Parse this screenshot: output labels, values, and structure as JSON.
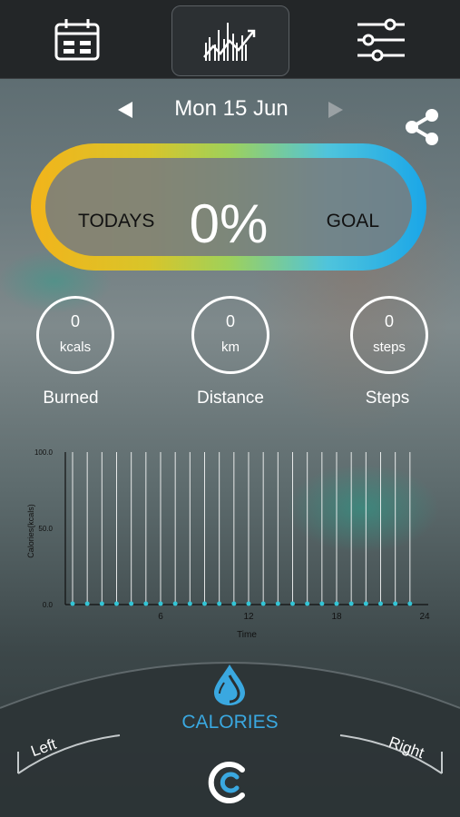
{
  "topbar": {
    "icons": [
      "calendar-icon",
      "chart-icon",
      "settings-sliders-icon"
    ]
  },
  "date": {
    "label": "Mon 15 Jun"
  },
  "goal": {
    "left_label": "TODAYS",
    "percent": "0%",
    "right_label": "GOAL",
    "progress": 0
  },
  "stats": [
    {
      "value": "0",
      "unit": "kcals",
      "label": "Burned"
    },
    {
      "value": "0",
      "unit": "km",
      "label": "Distance"
    },
    {
      "value": "0",
      "unit": "steps",
      "label": "Steps"
    }
  ],
  "colors": {
    "ring_start": "#f2b41b",
    "ring_end": "#1aa6e8",
    "accent": "#3aa8e0",
    "point": "#33c5d6"
  },
  "chart_data": {
    "type": "line",
    "xlabel": "Time",
    "ylabel": "Calories(kcals)",
    "ylim": [
      0,
      100
    ],
    "xlim": [
      0,
      24
    ],
    "yticks": [
      "0.0",
      "50.0",
      "100.0"
    ],
    "xticks": [
      "6",
      "12",
      "18",
      "24"
    ],
    "x": [
      0,
      1,
      2,
      3,
      4,
      5,
      6,
      7,
      8,
      9,
      10,
      11,
      12,
      13,
      14,
      15,
      16,
      17,
      18,
      19,
      20,
      21,
      22,
      23
    ],
    "series": [
      {
        "values": [
          0,
          0,
          0,
          0,
          0,
          0,
          0,
          0,
          0,
          0,
          0,
          0,
          0,
          0,
          0,
          0,
          0,
          0,
          0,
          0,
          0,
          0,
          0,
          0
        ]
      }
    ],
    "grid": "vertical"
  },
  "footer": {
    "mode_label": "CALORIES",
    "left_label": "Left",
    "right_label": "Right"
  }
}
